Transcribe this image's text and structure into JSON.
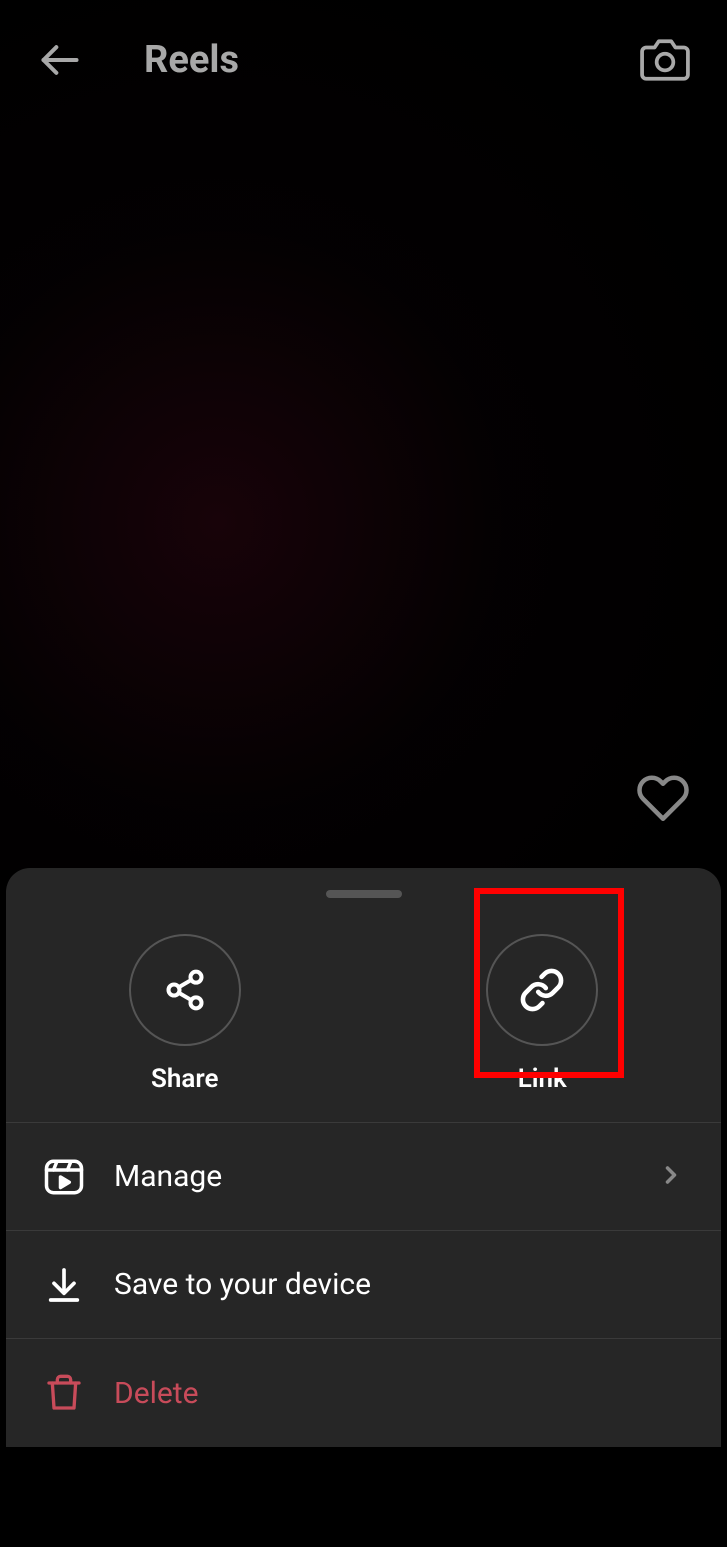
{
  "header": {
    "title": "Reels"
  },
  "actions": {
    "share_label": "Share",
    "link_label": "Link"
  },
  "menu": {
    "manage_label": "Manage",
    "save_label": "Save to your device",
    "delete_label": "Delete"
  }
}
